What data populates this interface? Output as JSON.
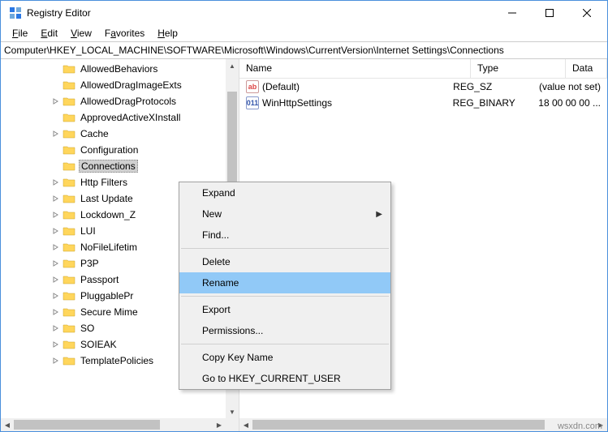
{
  "titlebar": {
    "title": "Registry Editor"
  },
  "menu": {
    "file": "File",
    "edit": "Edit",
    "view": "View",
    "favorites": "Favorites",
    "help": "Help"
  },
  "address": "Computer\\HKEY_LOCAL_MACHINE\\SOFTWARE\\Microsoft\\Windows\\CurrentVersion\\Internet Settings\\Connections",
  "tree": [
    {
      "label": "AllowedBehaviors",
      "expander": ""
    },
    {
      "label": "AllowedDragImageExts",
      "expander": ""
    },
    {
      "label": "AllowedDragProtocols",
      "expander": ">"
    },
    {
      "label": "ApprovedActiveXInstall",
      "expander": ""
    },
    {
      "label": "Cache",
      "expander": ">"
    },
    {
      "label": "Configuration",
      "expander": ""
    },
    {
      "label": "Connections",
      "expander": "",
      "selected": true
    },
    {
      "label": "Http Filters",
      "expander": ">"
    },
    {
      "label": "Last Update",
      "expander": ">"
    },
    {
      "label": "Lockdown_Z",
      "expander": ">"
    },
    {
      "label": "LUI",
      "expander": ">"
    },
    {
      "label": "NoFileLifetim",
      "expander": ">"
    },
    {
      "label": "P3P",
      "expander": ">"
    },
    {
      "label": "Passport",
      "expander": ">"
    },
    {
      "label": "PluggablePr",
      "expander": ">"
    },
    {
      "label": "Secure Mime",
      "expander": ">"
    },
    {
      "label": "SO",
      "expander": ">"
    },
    {
      "label": "SOIEAK",
      "expander": ">"
    },
    {
      "label": "TemplatePolicies",
      "expander": ">"
    }
  ],
  "columns": {
    "name": "Name",
    "type": "Type",
    "data": "Data"
  },
  "values": [
    {
      "icon": "str",
      "name": "(Default)",
      "type": "REG_SZ",
      "data": "(value not set)"
    },
    {
      "icon": "bin",
      "name": "WinHttpSettings",
      "type": "REG_BINARY",
      "data": "18 00 00 00 ..."
    }
  ],
  "context": [
    {
      "label": "Expand",
      "type": "item"
    },
    {
      "label": "New",
      "type": "item",
      "submenu": true
    },
    {
      "label": "Find...",
      "type": "item"
    },
    {
      "type": "sep"
    },
    {
      "label": "Delete",
      "type": "item"
    },
    {
      "label": "Rename",
      "type": "item",
      "highlighted": true
    },
    {
      "type": "sep"
    },
    {
      "label": "Export",
      "type": "item"
    },
    {
      "label": "Permissions...",
      "type": "item"
    },
    {
      "type": "sep"
    },
    {
      "label": "Copy Key Name",
      "type": "item"
    },
    {
      "label": "Go to HKEY_CURRENT_USER",
      "type": "item"
    }
  ],
  "watermark": "wsxdn.com"
}
